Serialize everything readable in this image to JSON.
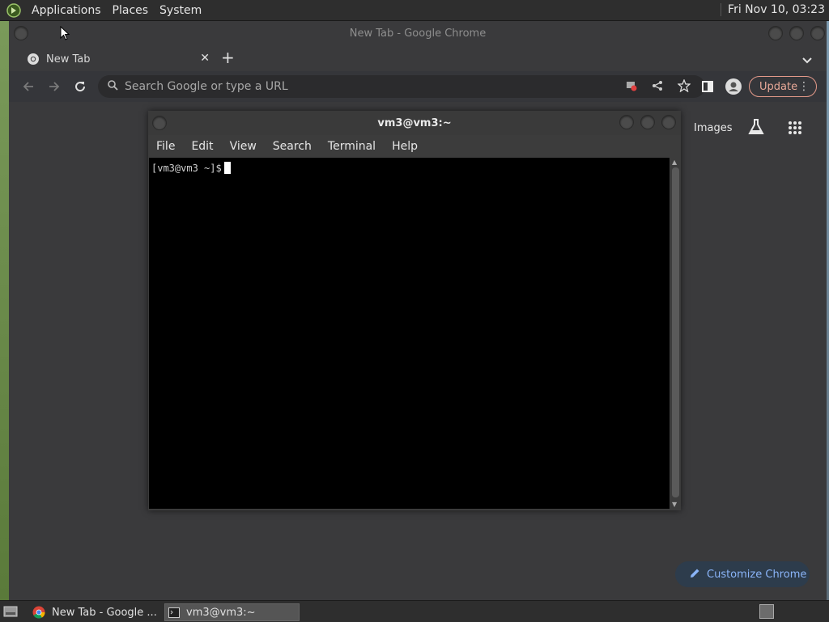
{
  "top_panel": {
    "menus": [
      "Applications",
      "Places",
      "System"
    ],
    "clock": "Fri Nov 10, 03:23"
  },
  "chrome": {
    "window_title": "New Tab - Google Chrome",
    "tab": {
      "label": "New Tab",
      "close": "✕"
    },
    "new_tab": "+",
    "omnibox_placeholder": "Search Google or type a URL",
    "update_label": "Update",
    "images_link": "Images",
    "customize_label": "Customize Chrome"
  },
  "terminal": {
    "title": "vm3@vm3:~",
    "menus": [
      "File",
      "Edit",
      "View",
      "Search",
      "Terminal",
      "Help"
    ],
    "prompt": "[vm3@vm3 ~]$"
  },
  "taskbar": {
    "items": [
      {
        "label": "New Tab - Google ..."
      },
      {
        "label": "vm3@vm3:~"
      }
    ]
  },
  "colors": {
    "panel": "#2e2e2e",
    "chrome_bg": "#3a3a3c",
    "accent_blue": "#8ab4f8",
    "update_border": "#e49a8a"
  }
}
